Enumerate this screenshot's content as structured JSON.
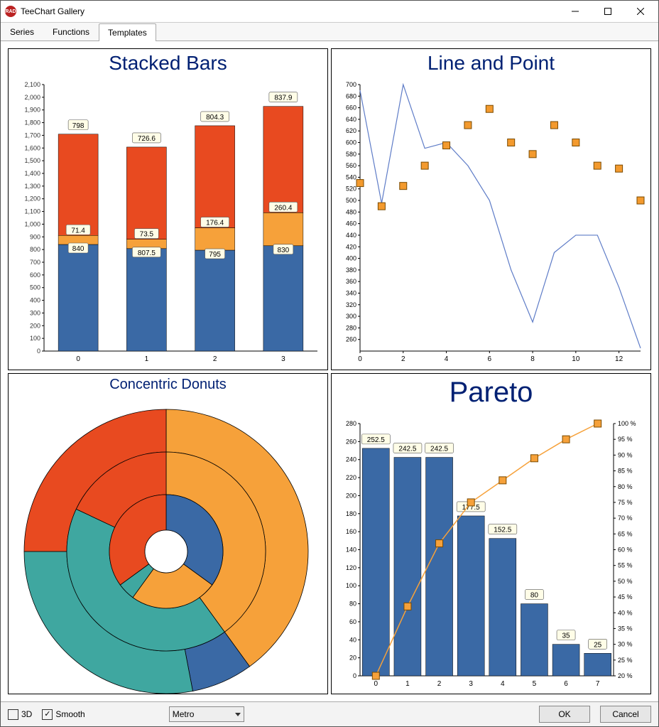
{
  "window": {
    "title": "TeeChart Gallery",
    "icon_text": "RAD"
  },
  "tabs": {
    "items": [
      "Series",
      "Functions",
      "Templates"
    ],
    "active": 2
  },
  "bottombar": {
    "checkbox_3d": {
      "label": "3D",
      "checked": false
    },
    "checkbox_smooth": {
      "label": "Smooth",
      "checked": true
    },
    "theme_value": "Metro",
    "ok": "OK",
    "cancel": "Cancel"
  },
  "stacked_title": "Stacked Bars",
  "line_point_title": "Line and Point",
  "donut_title": "Concentric Donuts",
  "pareto_title": "Pareto",
  "chart_data": [
    {
      "id": "stacked_bars",
      "type": "bar",
      "title": "Stacked Bars",
      "stacked": true,
      "categories": [
        "0",
        "1",
        "2",
        "3"
      ],
      "series": [
        {
          "name": "blue",
          "color": "#3a69a5",
          "values": [
            840,
            807.5,
            795,
            830
          ]
        },
        {
          "name": "orange",
          "color": "#f6a13a",
          "values": [
            71.4,
            73.5,
            176.4,
            260.4
          ]
        },
        {
          "name": "red",
          "color": "#e84a20",
          "values": [
            798,
            726.6,
            804.3,
            837.9
          ]
        }
      ],
      "ylim": [
        0,
        2100
      ],
      "y_ticks": [
        0,
        100,
        200,
        300,
        400,
        500,
        600,
        700,
        800,
        900,
        1000,
        1100,
        1200,
        1300,
        1400,
        1500,
        1600,
        1700,
        1800,
        1900,
        2000,
        2100
      ]
    },
    {
      "id": "line_and_point",
      "type": "line+scatter",
      "title": "Line and Point",
      "x": [
        0,
        1,
        2,
        3,
        4,
        5,
        6,
        7,
        8,
        9,
        10,
        11,
        12,
        13
      ],
      "line": {
        "color": "#5e7cc7",
        "values": [
          690,
          495,
          700,
          590,
          600,
          560,
          500,
          380,
          290,
          410,
          440,
          440,
          350,
          245
        ]
      },
      "points": {
        "color": "#f39a2e",
        "values": [
          530,
          490,
          525,
          560,
          595,
          630,
          658,
          600,
          580,
          630,
          600,
          560,
          555,
          500
        ]
      },
      "ylim": [
        240,
        700
      ],
      "y_ticks": [
        260,
        280,
        300,
        320,
        340,
        360,
        380,
        400,
        420,
        440,
        460,
        480,
        500,
        520,
        540,
        560,
        580,
        600,
        620,
        640,
        660,
        680,
        700
      ],
      "x_ticks": [
        0,
        2,
        4,
        6,
        8,
        10,
        12
      ]
    },
    {
      "id": "concentric_donuts",
      "type": "pie",
      "title": "Concentric Donuts",
      "rings": [
        {
          "level": "outer",
          "slices": [
            {
              "c": "#f6a13a",
              "v": 40
            },
            {
              "c": "#3a69a5",
              "v": 7
            },
            {
              "c": "#3fa7a0",
              "v": 28
            },
            {
              "c": "#e84a20",
              "v": 25
            }
          ]
        },
        {
          "level": "middle",
          "slices": [
            {
              "c": "#f6a13a",
              "v": 40
            },
            {
              "c": "#3fa7a0",
              "v": 42
            },
            {
              "c": "#e84a20",
              "v": 18
            }
          ]
        },
        {
          "level": "inner",
          "slices": [
            {
              "c": "#3a69a5",
              "v": 35
            },
            {
              "c": "#f6a13a",
              "v": 25
            },
            {
              "c": "#3fa7a0",
              "v": 5
            },
            {
              "c": "#e84a20",
              "v": 35
            }
          ]
        }
      ]
    },
    {
      "id": "pareto",
      "type": "bar+line",
      "title": "Pareto",
      "categories": [
        "0",
        "1",
        "2",
        "3",
        "4",
        "5",
        "6",
        "7"
      ],
      "bars": {
        "color": "#3a69a5",
        "values": [
          252.5,
          242.5,
          242.5,
          177.5,
          152.5,
          80,
          35,
          25
        ]
      },
      "line": {
        "color": "#f6a13a",
        "percent": [
          20,
          42,
          62,
          75,
          82,
          89,
          95,
          100
        ]
      },
      "ylim_left": [
        0,
        280
      ],
      "y_ticks_left": [
        0,
        20,
        40,
        60,
        80,
        100,
        120,
        140,
        160,
        180,
        200,
        220,
        240,
        260,
        280
      ],
      "ylim_right": [
        20,
        100
      ],
      "y_ticks_right": [
        "20 %",
        "25 %",
        "30 %",
        "35 %",
        "40 %",
        "45 %",
        "50 %",
        "55 %",
        "60 %",
        "65 %",
        "70 %",
        "75 %",
        "80 %",
        "85 %",
        "90 %",
        "95 %",
        "100 %"
      ]
    }
  ]
}
